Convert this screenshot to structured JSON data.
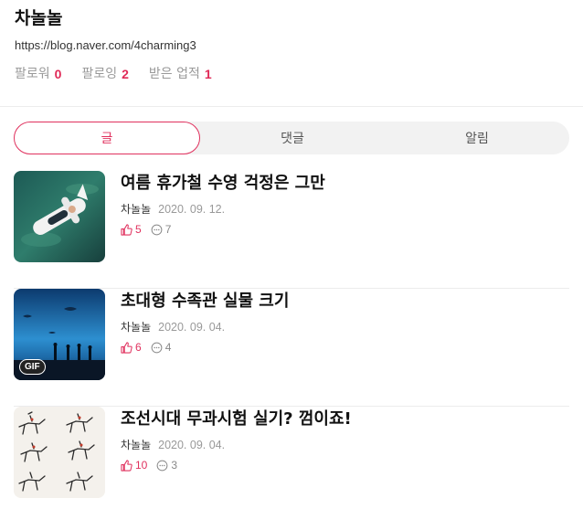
{
  "profile": {
    "name": "차놀놀",
    "url": "https://blog.naver.com/4charming3",
    "stats": [
      {
        "label": "팔로워",
        "value": "0"
      },
      {
        "label": "팔로잉",
        "value": "2"
      },
      {
        "label": "받은 업적",
        "value": "1"
      }
    ]
  },
  "tabs": [
    {
      "label": "글",
      "active": true
    },
    {
      "label": "댓글",
      "active": false
    },
    {
      "label": "알림",
      "active": false
    }
  ],
  "posts": [
    {
      "title": "여름 휴가철 수영 걱정은 그만",
      "author": "차놀놀",
      "date": "2020. 09. 12.",
      "likes": "5",
      "comments": "7",
      "thumbnail": "swimmer-on-float-image"
    },
    {
      "title": "초대형 수족관 실물 크기",
      "author": "차놀놀",
      "date": "2020. 09. 04.",
      "likes": "6",
      "comments": "4",
      "thumbnail": "aquarium-image",
      "badge": "GIF"
    },
    {
      "title": "조선시대 무과시험 실기? 껌이죠!",
      "author": "차놀놀",
      "date": "2020. 09. 04.",
      "likes": "10",
      "comments": "3",
      "thumbnail": "horse-riders-drawing-image"
    }
  ],
  "colors": {
    "accent": "#e0315e",
    "tab_bg": "#f2f2f2",
    "muted": "#999999"
  },
  "icons": {
    "likes": "thumbs-up-icon",
    "comments": "speech-bubble-icon"
  }
}
